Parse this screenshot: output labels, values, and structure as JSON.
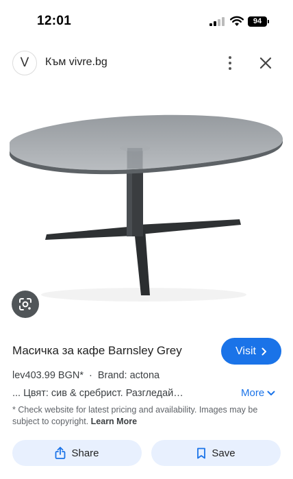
{
  "status_bar": {
    "time": "12:01",
    "battery": "94"
  },
  "header": {
    "site_logo_letter": "V",
    "site_link": "Към vivre.bg",
    "icons": [
      "more-vert-icon",
      "close-icon"
    ]
  },
  "image": {
    "description_icon": "google-lens-icon"
  },
  "product": {
    "title": "Масичка за кафе Barnsley Grey",
    "visit_label": "Visit",
    "price": "lev403.99 BGN*",
    "separator": "·",
    "brand": "Brand: actona",
    "description": "... Цвят: сив & сребрист. Разгледай…",
    "more_label": "More",
    "disclaimer": "* Check website for latest pricing and availability. Images may be subject to copyright.",
    "learn_more": "Learn More"
  },
  "actions": {
    "share_label": "Share",
    "save_label": "Save"
  },
  "colors": {
    "accent": "#1a73e8",
    "action_bg": "#e8f0fe"
  }
}
